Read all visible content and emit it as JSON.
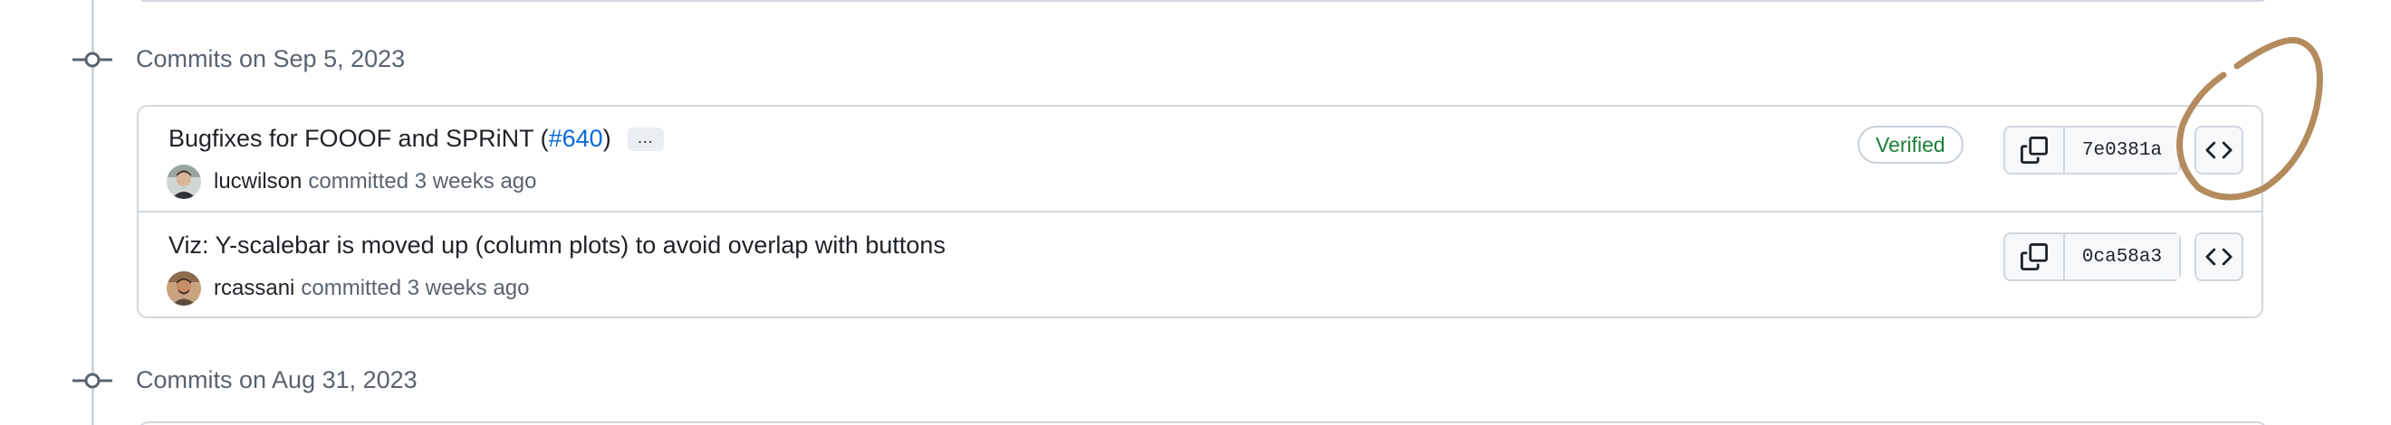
{
  "timeline": {
    "groups": [
      {
        "date_label": "Commits on Sep 5, 2023"
      },
      {
        "date_label": "Commits on Aug 31, 2023"
      }
    ]
  },
  "commits": [
    {
      "title": "Bugfixes for FOOOF and SPRiNT (",
      "pr_link": "#640",
      "title_suffix": ")",
      "ellipsis": "…",
      "author": "lucwilson",
      "meta": "committed 3 weeks ago",
      "badge": "Verified",
      "sha": "7e0381a"
    },
    {
      "title": "Viz: Y-scalebar is moved up (column plots) to avoid overlap with buttons",
      "author": "rcassani",
      "meta": "committed 3 weeks ago",
      "sha": "0ca58a3"
    }
  ],
  "colors": {
    "link": "#0969da",
    "verified": "#1a7f37",
    "annotation_stroke": "#b38b5d"
  },
  "icons": {
    "commit_node": "git-commit-icon",
    "copy": "copy-icon",
    "browse": "code-icon"
  }
}
